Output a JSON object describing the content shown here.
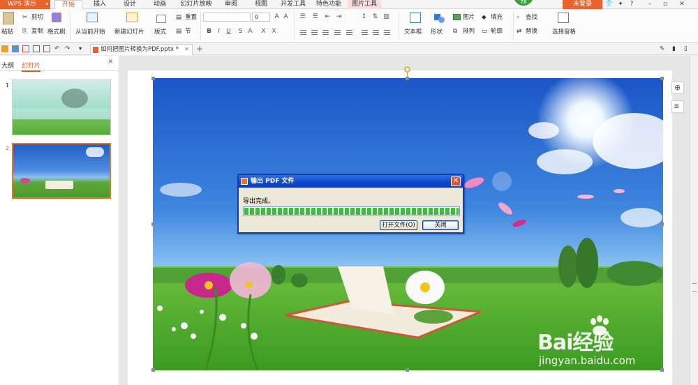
{
  "app": {
    "logo_label": "WPS 演示"
  },
  "tabs": [
    {
      "label": "开始",
      "active": true
    },
    {
      "label": "插入"
    },
    {
      "label": "设计"
    },
    {
      "label": "动画"
    },
    {
      "label": "幻灯片放映"
    },
    {
      "label": "审阅"
    },
    {
      "label": "视图"
    },
    {
      "label": "开发工具"
    },
    {
      "label": "特色功能"
    },
    {
      "label": "图片工具"
    }
  ],
  "titlebar": {
    "login": "未登录",
    "badge": "78"
  },
  "ribbon": {
    "paste": "粘贴",
    "cut": "剪切",
    "copy": "复制",
    "format_painter": "格式刷",
    "from_current": "从当前开始",
    "new_slide": "新建幻灯片",
    "layout": "版式",
    "reset": "重置",
    "section": "节",
    "font_size": "0",
    "textbox": "文本框",
    "shape": "形状",
    "picture": "图片",
    "arrange": "排列",
    "fill": "填充",
    "outline": "轮廓",
    "find": "查找",
    "replace": "替换",
    "select_pane": "选择窗格"
  },
  "document": {
    "tab_title": "如何把图片转换为PDF.pptx *"
  },
  "left_pane": {
    "tab_outline": "大纲",
    "tab_slides": "幻灯片",
    "slide_numbers": [
      "1",
      "2"
    ]
  },
  "dialog": {
    "title": "输出 PDF 文件",
    "message": "导出完成。",
    "progress": 1.0,
    "btn_open": "打开文件(O)",
    "btn_close": "关闭"
  },
  "watermark": {
    "brand": "Bai经验",
    "url": "jingyan.baidu.com"
  },
  "colors": {
    "accent": "#e8642c",
    "dialog_title": "#0b46c9",
    "progress": "#36c03b"
  }
}
